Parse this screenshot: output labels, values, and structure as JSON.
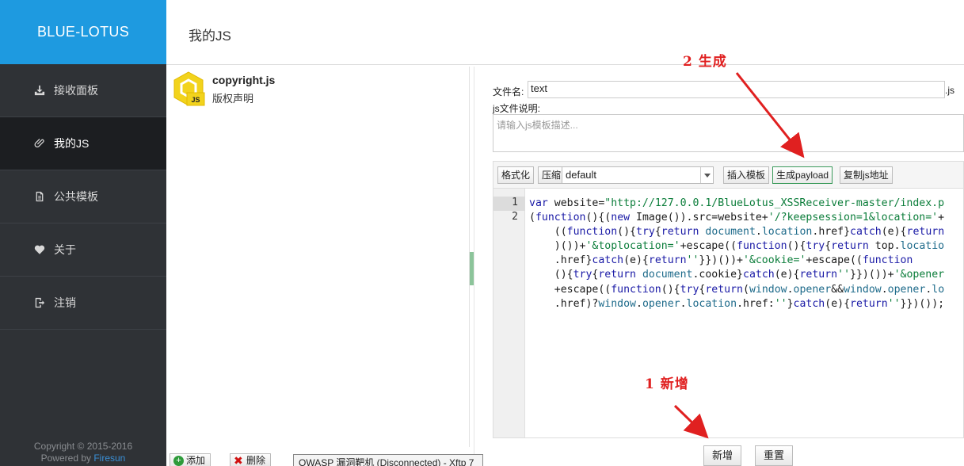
{
  "sidebar": {
    "brand": "BLUE-LOTUS",
    "items": [
      {
        "label": "接收面板",
        "icon": "download-tray-icon"
      },
      {
        "label": "我的JS",
        "icon": "paperclip-icon"
      },
      {
        "label": "公共模板",
        "icon": "document-icon"
      },
      {
        "label": "关于",
        "icon": "heart-icon"
      },
      {
        "label": "注销",
        "icon": "logout-icon"
      }
    ],
    "active_index": 1,
    "copyright_line1": "Copyright © 2015-2016",
    "powered_by": "Powered by",
    "powered_link": "Firesun"
  },
  "header": {
    "title": "我的JS"
  },
  "list": {
    "items": [
      {
        "name": "copyright.js",
        "desc": "版权声明",
        "badge": "JS"
      }
    ]
  },
  "bottom_toolbar": {
    "add_label": "添加",
    "delete_label": "删除",
    "taskbar_tip": "OWASP 漏洞靶机 (Disconnected) - Xftp 7"
  },
  "editor": {
    "filename_label": "文件名:",
    "filename_value": "text",
    "filename_ext": ".js",
    "desc_label": "js文件说明:",
    "desc_placeholder": "请输入js模板描述...",
    "toolbar": {
      "format_label": "格式化",
      "compress_label": "压缩",
      "template_select": "default",
      "insert_template_label": "插入模板",
      "generate_payload_label": "生成payload",
      "copy_url_label": "复制js地址"
    },
    "line_numbers": [
      "1",
      "2"
    ],
    "add_button": "新增",
    "reset_button": "重置"
  },
  "annotations": {
    "step1": "1 新增",
    "step2": "2 生成"
  },
  "colors": {
    "brand_blue": "#1e9ae0",
    "sidebar_bg": "#2f3236",
    "active_bg": "#1c1e21",
    "annotation_red": "#e02020"
  }
}
